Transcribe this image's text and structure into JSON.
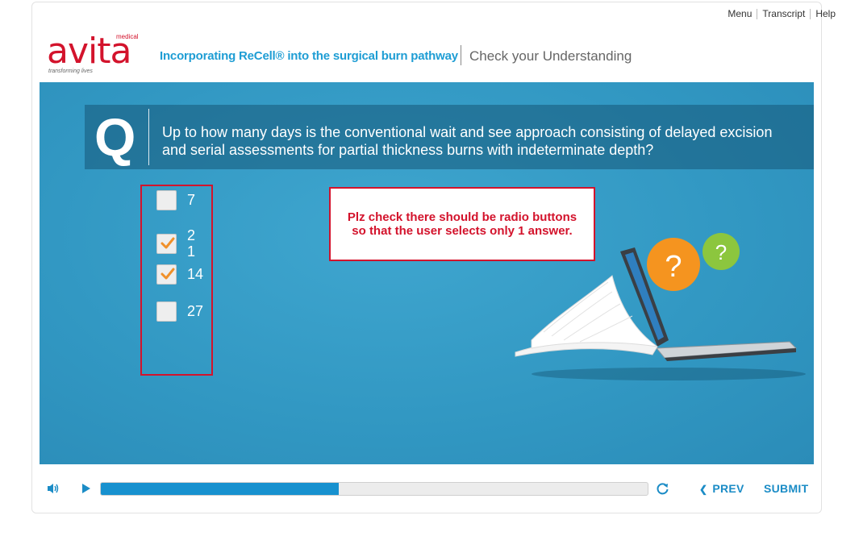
{
  "top_links": [
    "Menu",
    "Transcript",
    "Help"
  ],
  "logo": {
    "word": "avita",
    "superscript": "medical",
    "tagline": "transforming lives"
  },
  "header": {
    "course_title": "Incorporating ReCell® into the surgical burn pathway",
    "slide_title": "Check your Understanding"
  },
  "question": {
    "letter": "Q",
    "text": "Up to how many days is the conventional wait and see approach consisting of delayed excision and serial assessments for partial thickness burns with indeterminate depth?"
  },
  "options": [
    {
      "label": "7",
      "checked": false
    },
    {
      "label": "21",
      "checked": true
    },
    {
      "label": "14",
      "checked": true
    },
    {
      "label": "27",
      "checked": false
    }
  ],
  "annotation": {
    "text": "Plz check there should be radio buttons so that the user selects only 1 answer."
  },
  "illustration": {
    "bubbles": [
      "?",
      "?"
    ]
  },
  "controls": {
    "progress": 0.435,
    "prev_label": "PREV",
    "submit_label": "SUBMIT",
    "icons": [
      "volume-icon",
      "play-icon",
      "replay-icon",
      "chevron-left-icon"
    ]
  },
  "colors": {
    "brand_red": "#d3132c",
    "accent_blue": "#1e9dd4",
    "stage_blue": "#3197c2",
    "checkmark_orange": "#f0902a",
    "bubble_orange": "#f5941f",
    "bubble_green": "#8cc63e"
  }
}
